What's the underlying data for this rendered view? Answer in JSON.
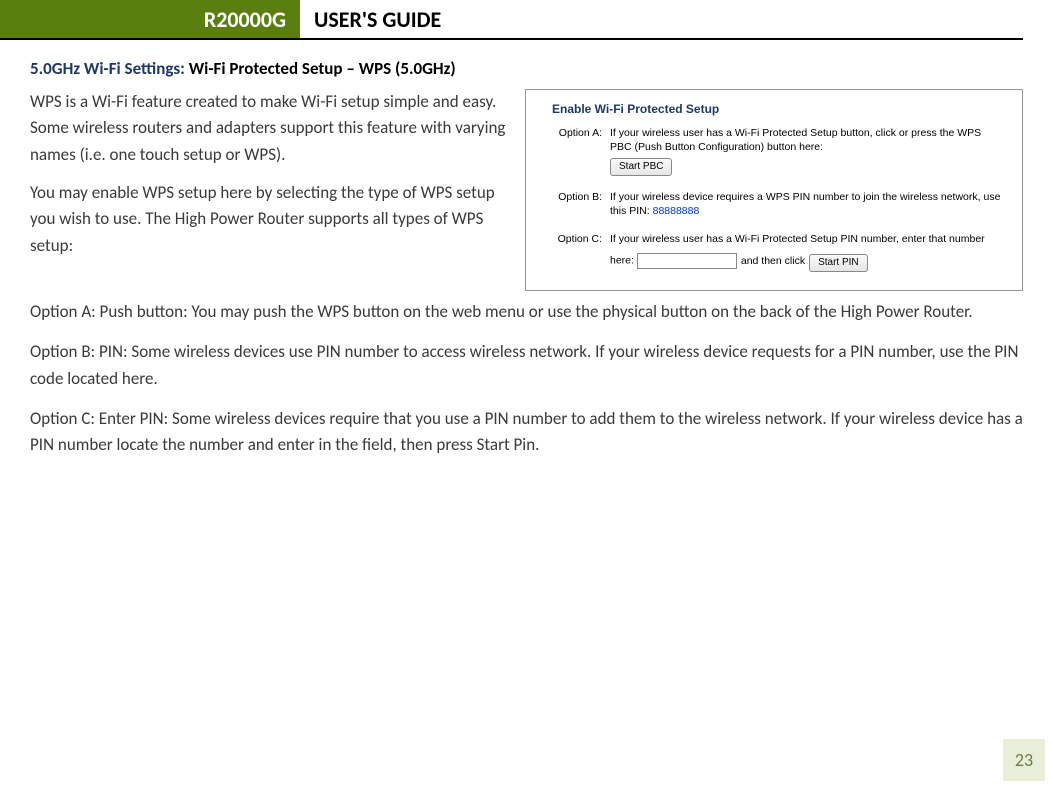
{
  "header": {
    "model": "R20000G",
    "title": "USER'S GUIDE"
  },
  "section": {
    "prefix": "5.0GHz Wi-Fi Settings:",
    "suffix": "Wi-Fi Protected Setup – WPS (5.0GHz)"
  },
  "intro": {
    "p1": "WPS is a Wi-Fi feature created to make Wi-Fi setup simple and easy.  Some wireless routers and adapters support this feature with varying names (i.e. one touch setup or WPS).",
    "p2": "You may enable WPS setup here by selecting the type of WPS setup you wish to use.  The High Power Router supports all types of WPS setup:"
  },
  "paras": {
    "a": "Option A: Push button: You may push the WPS button on the web menu or use the physical button on the back of the High Power Router.",
    "b": "Option B: PIN: Some wireless devices use PIN number to access wireless network.  If your wireless device requests for a PIN number, use the PIN code located here.",
    "c": "Option C: Enter PIN: Some wireless devices require that you use a PIN number to add them to the wireless network.  If your wireless device has a PIN number locate the number and enter in the field, then press Start Pin."
  },
  "wps": {
    "heading": "Enable Wi-Fi Protected Setup",
    "a": {
      "label": "Option A:",
      "text": "If your wireless user has a Wi-Fi Protected Setup button, click or press the WPS PBC (Push Button Configuration) button here:",
      "button": "Start PBC"
    },
    "b": {
      "label": "Option B:",
      "text_pre": "If your wireless device requires a WPS PIN number to join the wireless network, use this PIN: ",
      "pin": "88888888"
    },
    "c": {
      "label": "Option C:",
      "text": "If your wireless user has a Wi-Fi Protected Setup PIN number, enter that number here:",
      "and_then": "and then click",
      "button": "Start PIN"
    }
  },
  "page_number": "23"
}
